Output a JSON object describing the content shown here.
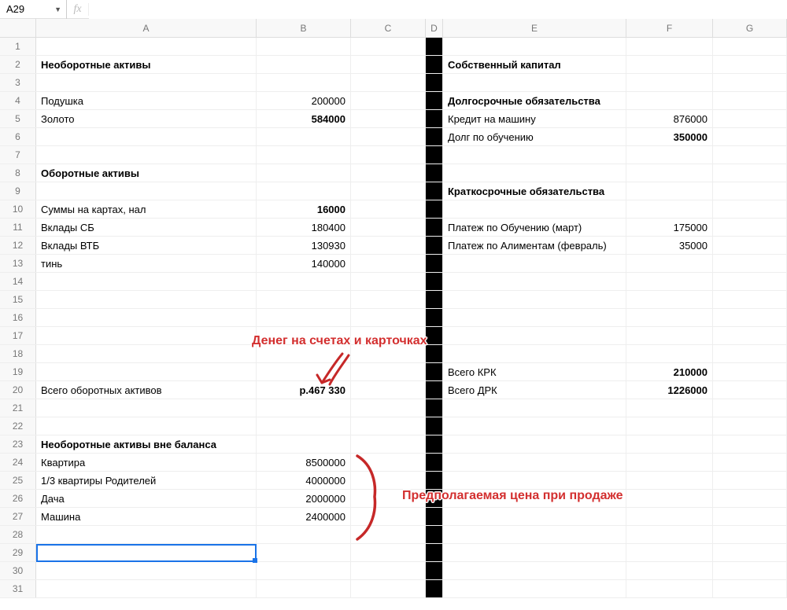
{
  "namebox": {
    "value": "A29"
  },
  "fx": {
    "value": ""
  },
  "columns": [
    "A",
    "B",
    "C",
    "D",
    "E",
    "F",
    "G"
  ],
  "rowcount": 31,
  "cells": {
    "r2": {
      "A": {
        "t": "Необоротные активы",
        "bold": true
      },
      "E": {
        "t": "Собственный капитал",
        "bold": true
      }
    },
    "r4": {
      "A": {
        "t": "Подушка"
      },
      "B": {
        "t": "200000"
      },
      "E": {
        "t": "Долгосрочные обязательства",
        "bold": true
      }
    },
    "r5": {
      "A": {
        "t": "Золото"
      },
      "B": {
        "t": "584000",
        "bold": true
      },
      "E": {
        "t": "Кредит на машину"
      },
      "F": {
        "t": "876000"
      }
    },
    "r6": {
      "E": {
        "t": "Долг по обучению"
      },
      "F": {
        "t": "350000",
        "bold": true
      }
    },
    "r8": {
      "A": {
        "t": "Оборотные активы",
        "bold": true
      }
    },
    "r9": {
      "E": {
        "t": "Краткосрочные обязательства",
        "bold": true
      }
    },
    "r10": {
      "A": {
        "t": "Суммы на картах, нал"
      },
      "B": {
        "t": "16000",
        "bold": true
      }
    },
    "r11": {
      "A": {
        "t": "Вклады СБ"
      },
      "B": {
        "t": "180400"
      },
      "E": {
        "t": "Платеж по Обучению (март)"
      },
      "F": {
        "t": "175000"
      }
    },
    "r12": {
      "A": {
        "t": "Вклады ВТБ"
      },
      "B": {
        "t": "130930"
      },
      "E": {
        "t": "Платеж по Алиментам (февраль)"
      },
      "F": {
        "t": "35000"
      }
    },
    "r13": {
      "A": {
        "t": "тинь"
      },
      "B": {
        "t": "140000"
      }
    },
    "r19": {
      "E": {
        "t": "Всего КРК"
      },
      "F": {
        "t": "210000",
        "bold": true
      }
    },
    "r20": {
      "A": {
        "t": "Всего оборотных активов"
      },
      "B": {
        "t": "р.467 330",
        "bold": true
      },
      "E": {
        "t": "Всего ДРК"
      },
      "F": {
        "t": "1226000",
        "bold": true
      }
    },
    "r23": {
      "A": {
        "t": "Необоротные активы вне баланса",
        "bold": true
      }
    },
    "r24": {
      "A": {
        "t": "Квартира"
      },
      "B": {
        "t": "8500000"
      }
    },
    "r25": {
      "A": {
        "t": "1/3 квартиры Родителей"
      },
      "B": {
        "t": "4000000"
      }
    },
    "r26": {
      "A": {
        "t": "Дача"
      },
      "B": {
        "t": "2000000"
      }
    },
    "r27": {
      "A": {
        "t": "Машина"
      },
      "B": {
        "t": "2400000"
      }
    }
  },
  "selected": {
    "ref": "A29"
  },
  "annotations": {
    "money_on_accounts": "Денег на счетах и карточках",
    "expected_sale_price": "Предполагаемая цена при продаже"
  }
}
